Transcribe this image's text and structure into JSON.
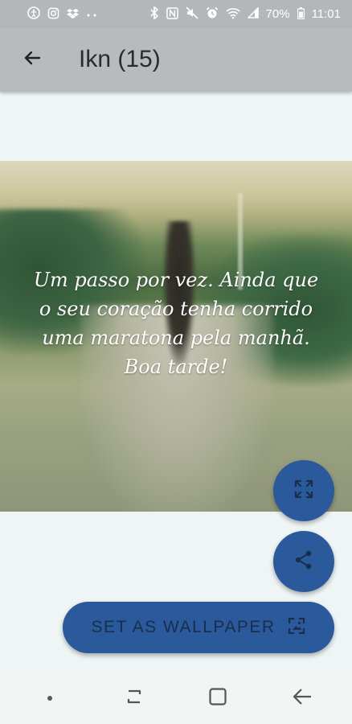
{
  "status_bar": {
    "battery_percent": "70%",
    "time": "11:01",
    "icons": [
      "accessibility-icon",
      "instagram-icon",
      "dropbox-icon",
      "more-dots-icon",
      "bluetooth-icon",
      "nfc-icon",
      "mute-icon",
      "alarm-icon",
      "wifi-icon",
      "signal-icon",
      "battery-icon"
    ]
  },
  "app_bar": {
    "title": "Ikn (15)",
    "back_icon": "arrow-left-icon"
  },
  "image": {
    "quote": "Um passo por vez. Ainda que o seu coração tenha corrido uma maratona pela manhã. Boa tarde!"
  },
  "actions": {
    "fullscreen_icon": "fullscreen-icon",
    "share_icon": "share-icon",
    "wallpaper_label": "SET AS WALLPAPER",
    "wallpaper_icon": "wallpaper-icon"
  },
  "nav_bar": {
    "items": [
      "dot-icon",
      "recents-icon",
      "home-icon",
      "back-icon"
    ]
  },
  "colors": {
    "accent": "#2a5a9c",
    "app_bar": "#b8bbbc",
    "status_bar": "#b4b7b8",
    "background": "#eef5f4",
    "nav_bar": "#f3f4f4"
  }
}
